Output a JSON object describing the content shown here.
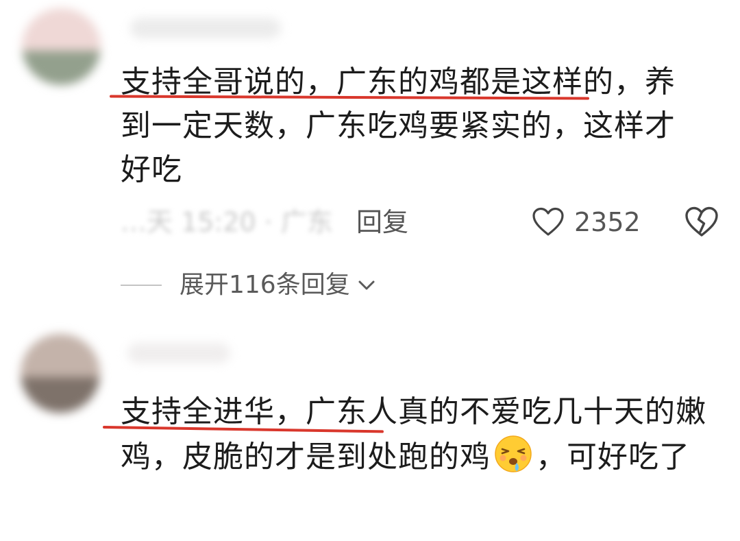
{
  "comments": [
    {
      "text": "支持全哥说的，广东的鸡都是这样的，养到一定天数，广东吃鸡要紧实的，这样才好吃",
      "meta_time": "…天 15:20 · 广东",
      "reply_label": "回复",
      "like_count": "2352",
      "expand_label": "展开116条回复"
    },
    {
      "text_before_emoji": "支持全进华，广东人真的不爱吃几十天的嫩鸡，皮脆的才是到处跑的鸡",
      "emoji": "drooling-face-emoji",
      "text_after_emoji": "，可好吃了"
    }
  ],
  "colors": {
    "underline": "#d9372c",
    "text": "#1c1c1c",
    "secondary": "#555555",
    "emoji": "#ffcc33"
  }
}
